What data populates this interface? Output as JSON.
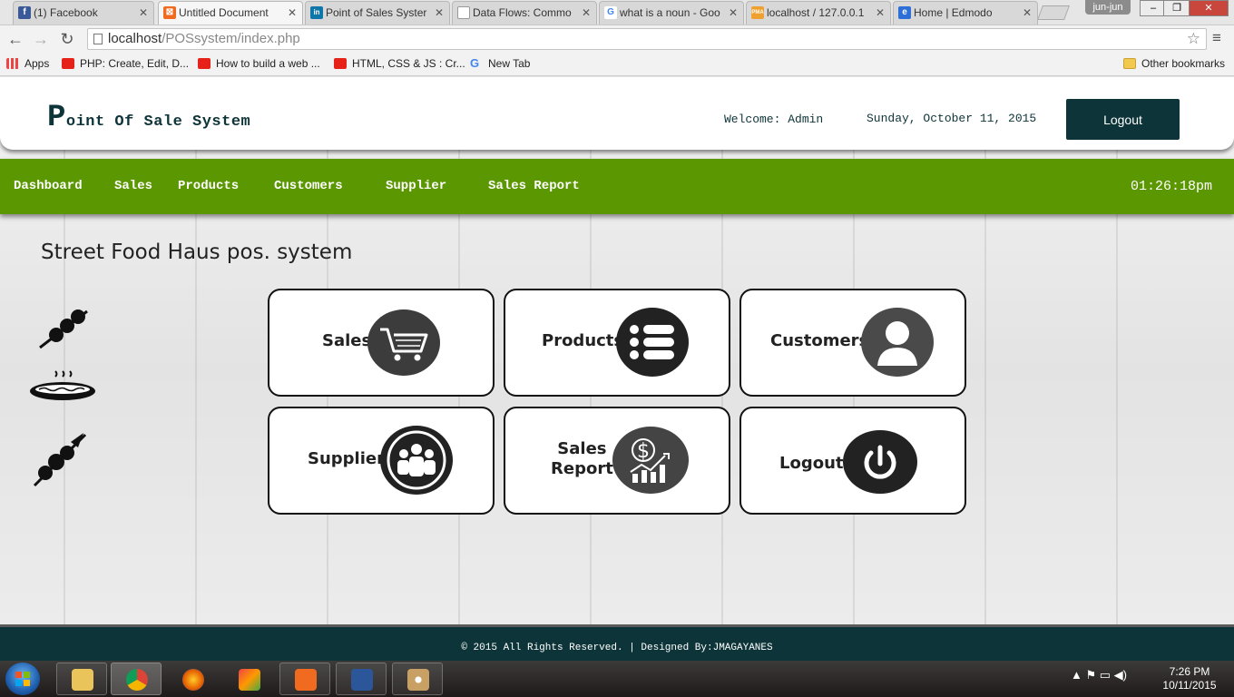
{
  "browser": {
    "tabs": [
      {
        "title": "(1) Facebook",
        "favicon_color": "#3b5998",
        "glyph": "f"
      },
      {
        "title": "Untitled Document",
        "favicon_color": "#f06b1f",
        "glyph": "⊠"
      },
      {
        "title": "Point of Sales Syster",
        "favicon_color": "#0e76a8",
        "glyph": "in"
      },
      {
        "title": "Data Flows: Commo",
        "favicon_color": "#ffffff",
        "glyph": ""
      },
      {
        "title": "what is a noun - Goo",
        "favicon_color": "#ffffff",
        "glyph": "G"
      },
      {
        "title": "localhost / 127.0.0.1",
        "favicon_color": "#f0a030",
        "glyph": "PMA"
      },
      {
        "title": "Home | Edmodo",
        "favicon_color": "#2d6fd8",
        "glyph": "e"
      }
    ],
    "profile": "jun-jun",
    "url_host": "localhost",
    "url_path": "/POSsystem/index.php",
    "bookmarks": [
      {
        "label": "Apps",
        "icon": "apps-icon"
      },
      {
        "label": "PHP: Create, Edit, D...",
        "icon": "youtube-icon"
      },
      {
        "label": "How to build a web ...",
        "icon": "youtube-icon"
      },
      {
        "label": "HTML, CSS & JS : Cr...",
        "icon": "youtube-icon"
      },
      {
        "label": "New Tab",
        "icon": "google-icon"
      }
    ],
    "other_bookmarks": "Other bookmarks"
  },
  "header": {
    "brand_first": "P",
    "brand_rest": "oint Of Sale System",
    "welcome": "Welcome: Admin",
    "date": "Sunday, October 11, 2015",
    "logout_label": "Logout"
  },
  "nav": {
    "items": [
      "Dashboard",
      "Sales",
      "Products",
      "Customers",
      "Supplier",
      "Sales Report"
    ],
    "clock": "01:26:18pm"
  },
  "main": {
    "store_title": "Street Food Haus pos. system",
    "tiles": [
      {
        "label": "Sales",
        "icon": "shopping-cart-icon"
      },
      {
        "label": "Products",
        "icon": "list-icon"
      },
      {
        "label": "Customers",
        "icon": "user-icon"
      },
      {
        "label": "Supplier",
        "icon": "group-icon"
      },
      {
        "label": "Sales Report",
        "line1": "Sales",
        "line2": "Report",
        "icon": "sales-chart-icon"
      },
      {
        "label": "Logout",
        "icon": "power-icon"
      }
    ]
  },
  "footer": {
    "text": "© 2015 All Rights Reserved. | Designed By:JMAGAYANES"
  },
  "taskbar": {
    "time": "7:26 PM",
    "date": "10/11/2015"
  },
  "colors": {
    "nav_green": "#5a9700",
    "dark_teal": "#0d3438"
  }
}
